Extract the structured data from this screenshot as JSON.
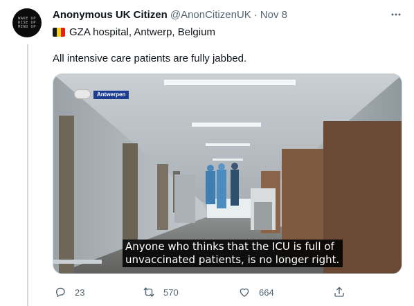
{
  "author": {
    "display_name": "Anonymous UK Citizen",
    "handle": "@AnonCitizenUK",
    "separator": "·",
    "timestamp": "Nov 8",
    "avatar_text": [
      "WAKE UP",
      "RISE UP",
      "MIND UP"
    ]
  },
  "location": {
    "text": "GZA hospital, Antwerp, Belgium",
    "flag_colors": [
      "#1a1a1a",
      "#f7d117",
      "#e2211c"
    ]
  },
  "tweet": {
    "text": "All intensive care patients are fully jabbed."
  },
  "media": {
    "channel_tag": "Antwerpen",
    "subtitle_lines": [
      "Anyone who thinks that the ICU is full of",
      "unvaccinated patients, is no longer right."
    ]
  },
  "actions": {
    "reply": {
      "icon": "reply-icon",
      "count": "23"
    },
    "retweet": {
      "icon": "retweet-icon",
      "count": "570"
    },
    "like": {
      "icon": "like-icon",
      "count": "664"
    },
    "share": {
      "icon": "share-icon"
    }
  },
  "colors": {
    "text_primary": "#0f1419",
    "text_secondary": "#536471",
    "thread_line": "#cfd9de",
    "news_chip": "#1c3d8f"
  }
}
